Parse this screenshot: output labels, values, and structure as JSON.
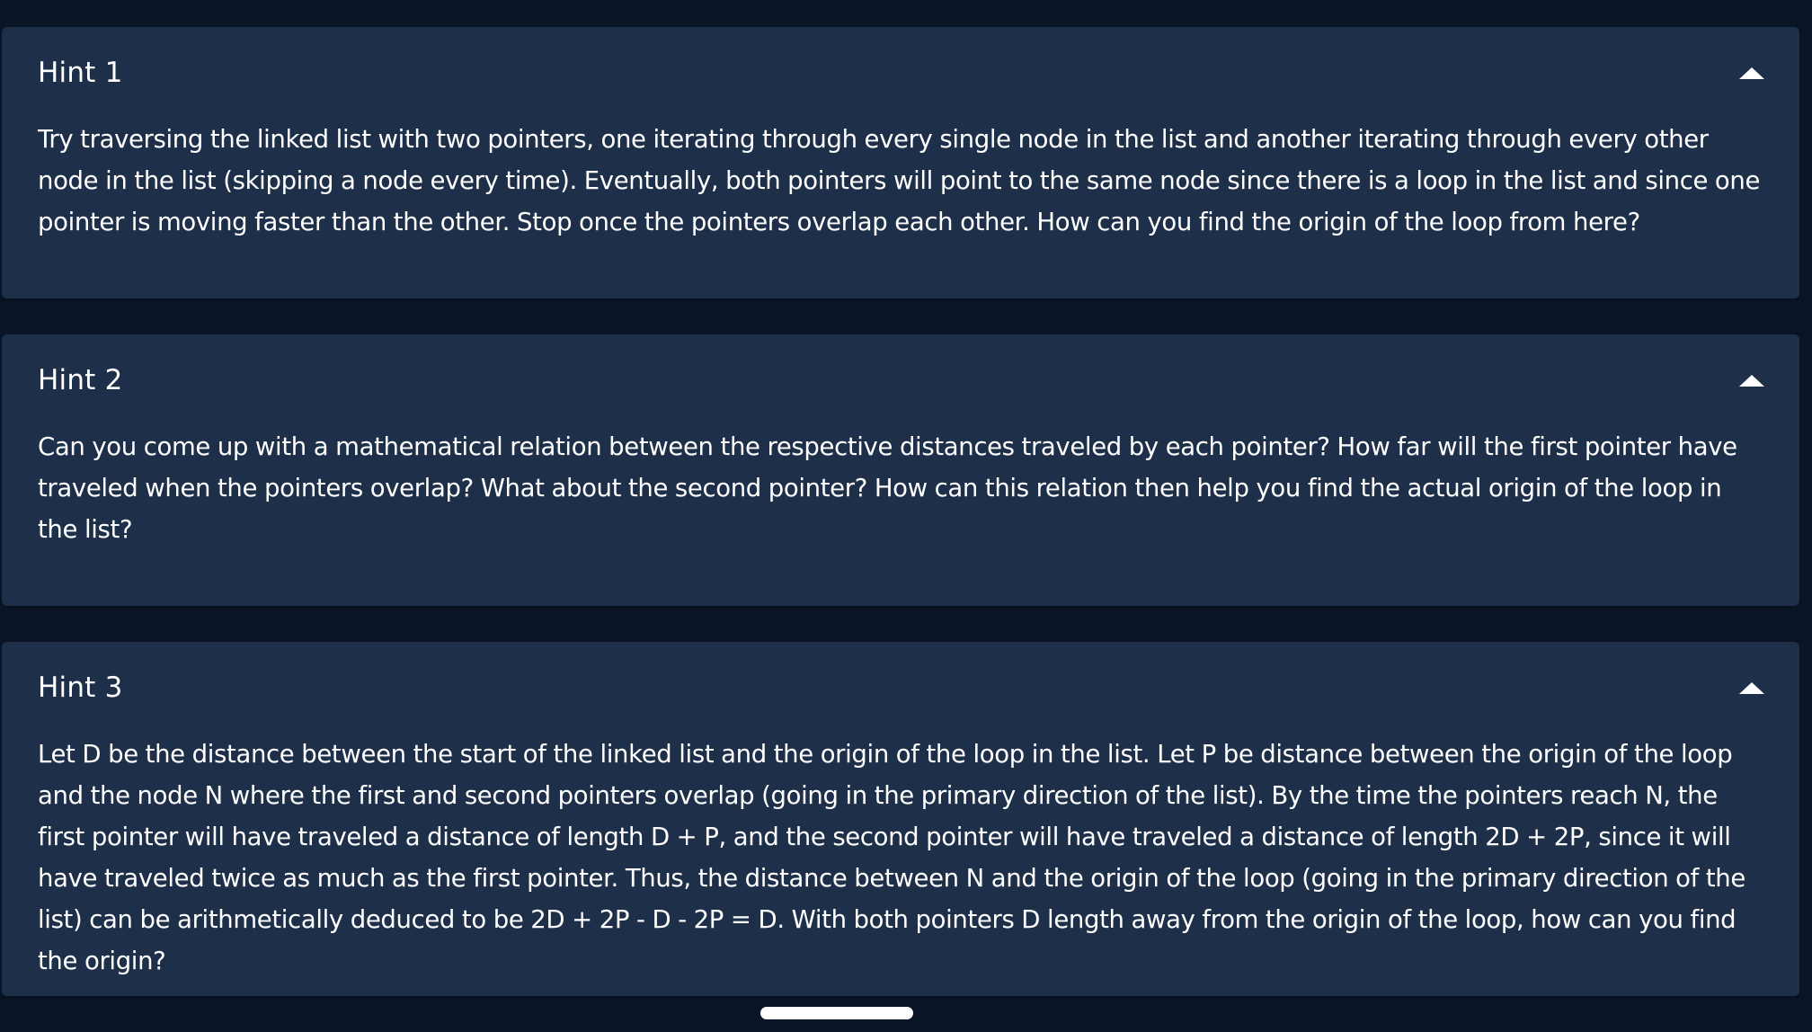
{
  "hints": [
    {
      "title": "Hint 1",
      "expanded": true,
      "icon": "chevron-up-icon",
      "text": "Try traversing the linked list with two pointers, one iterating through every single node in the list and another iterating through every other node in the list (skipping a node every time). Eventually, both pointers will point to the same node since there is a loop in the list and since one pointer is moving faster than the other. Stop once the pointers overlap each other. How can you find the origin of the loop from here?"
    },
    {
      "title": "Hint 2",
      "expanded": true,
      "icon": "chevron-up-icon",
      "text": "Can you come up with a mathematical relation between the respective distances traveled by each pointer? How far will the first pointer have traveled when the pointers overlap? What about the second pointer? How can this relation then help you find the actual origin of the loop in the list?"
    },
    {
      "title": "Hint 3",
      "expanded": true,
      "icon": "chevron-up-icon",
      "text": "Let D be the distance between the start of the linked list and the origin of the loop in the list. Let P be distance between the origin of the loop and the node N where the first and second pointers overlap (going in the primary direction of the list). By the time the pointers reach N, the first pointer will have traveled a distance of length D + P, and the second pointer will have traveled a distance of length 2D + 2P, since it will have traveled twice as much as the first pointer. Thus, the distance between N and the origin of the loop (going in the primary direction of the list) can be arithmetically deduced to be 2D + 2P - D - 2P = D. With both pointers D length away from the origin of the loop, how can you find the origin?"
    }
  ],
  "colors": {
    "page_background": "#0a1628",
    "card_background": "#1e2f49",
    "text": "#ffffff"
  }
}
